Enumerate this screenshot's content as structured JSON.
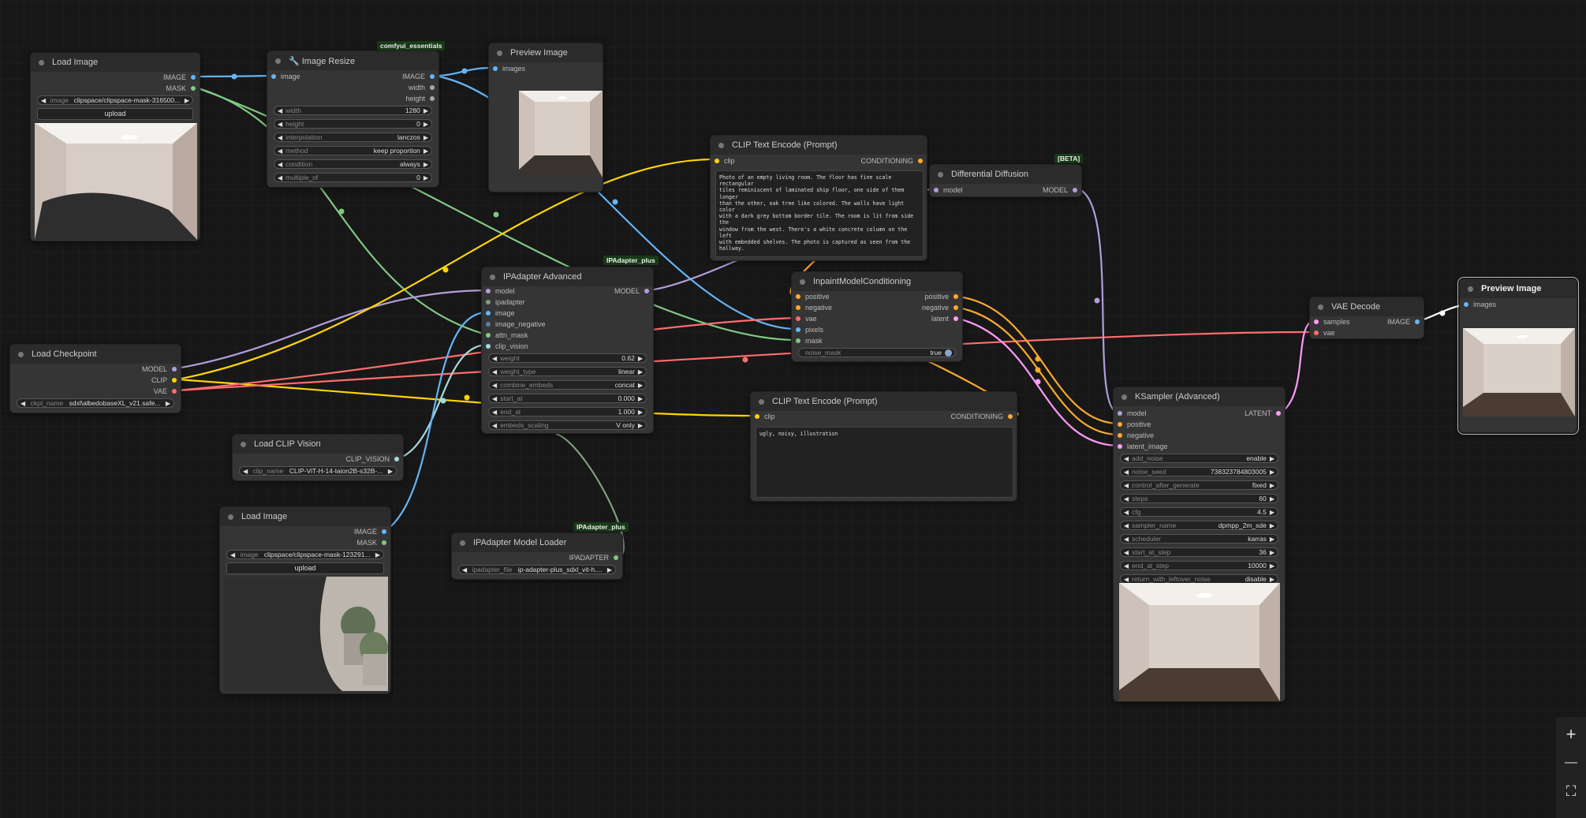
{
  "nodes": {
    "load_image_1": {
      "title": "Load Image",
      "out_image": "IMAGE",
      "out_mask": "MASK",
      "widget_label": "image",
      "widget_value": "clipspace/clipspace-mask-316500...",
      "upload": "upload"
    },
    "image_resize": {
      "badge": "comfyui_essentials",
      "title": "🔧 Image Resize",
      "in_image": "image",
      "out_image": "IMAGE",
      "out_width": "width",
      "out_height": "height",
      "widgets": [
        {
          "label": "width",
          "value": "1280"
        },
        {
          "label": "height",
          "value": "0"
        },
        {
          "label": "interpolation",
          "value": "lanczos"
        },
        {
          "label": "method",
          "value": "keep proportion"
        },
        {
          "label": "condition",
          "value": "always"
        },
        {
          "label": "multiple_of",
          "value": "0"
        }
      ]
    },
    "preview_image_1": {
      "title": "Preview Image",
      "in_images": "images"
    },
    "clip_text_1": {
      "title": "CLIP Text Encode (Prompt)",
      "in_clip": "clip",
      "out_cond": "CONDITIONING",
      "text": "Photo of an empty living room. The floor has fine scale rectangular\ntiles reminiscent of laminated ship floor, one side of them longer\nthan the other, oak tree like colored. The walls have light color\nwith a dark grey bottom border tile. The room is lit from side the\nwindow from the west. There's a white concrete column on the left\nwith embedded shelves. The photo is captured as seen from the\nhallway."
    },
    "diff_diffusion": {
      "badge": "[BETA]",
      "title": "Differential Diffusion",
      "in_model": "model",
      "out_model": "MODEL"
    },
    "ipadapter_adv": {
      "badge": "IPAdapter_plus",
      "title": "IPAdapter Advanced",
      "inputs": [
        "model",
        "ipadapter",
        "image",
        "image_negative",
        "attn_mask",
        "clip_vision"
      ],
      "out_model": "MODEL",
      "widgets": [
        {
          "label": "weight",
          "value": "0.62"
        },
        {
          "label": "weight_type",
          "value": "linear"
        },
        {
          "label": "combine_embeds",
          "value": "concat"
        },
        {
          "label": "start_at",
          "value": "0.000"
        },
        {
          "label": "end_at",
          "value": "1.000"
        },
        {
          "label": "embeds_scaling",
          "value": "V only"
        }
      ]
    },
    "inpaint_cond": {
      "title": "InpaintModelConditioning",
      "inputs": [
        "positive",
        "negative",
        "vae",
        "pixels",
        "mask"
      ],
      "outputs": [
        "positive",
        "negative",
        "latent"
      ],
      "toggle_label": "noise_mask",
      "toggle_value": "true"
    },
    "load_checkpoint": {
      "title": "Load Checkpoint",
      "outputs": [
        "MODEL",
        "CLIP",
        "VAE"
      ],
      "widget_label": "ckpt_name",
      "widget_value": "sdxl\\albedobaseXL_v21.safe..."
    },
    "clip_text_2": {
      "title": "CLIP Text Encode (Prompt)",
      "in_clip": "clip",
      "out_cond": "CONDITIONING",
      "text": "ugly, noisy, illustration"
    },
    "load_clip_vision": {
      "title": "Load CLIP Vision",
      "out": "CLIP_VISION",
      "widget_label": "clip_name",
      "widget_value": "CLIP-ViT-H-14-laion2B-s32B-..."
    },
    "load_image_2": {
      "title": "Load Image",
      "out_image": "IMAGE",
      "out_mask": "MASK",
      "widget_label": "image",
      "widget_value": "clipspace/clipspace-mask-123291...",
      "upload": "upload"
    },
    "ipadapter_loader": {
      "badge": "IPAdapter_plus",
      "title": "IPAdapter Model Loader",
      "out": "IPADAPTER",
      "widget_label": "ipadapter_file",
      "widget_value": "ip-adapter-plus_sdxl_vit-h...."
    },
    "vae_decode": {
      "title": "VAE Decode",
      "inputs": [
        "samples",
        "vae"
      ],
      "out": "IMAGE"
    },
    "ksampler": {
      "title": "KSampler (Advanced)",
      "inputs": [
        "model",
        "positive",
        "negative",
        "latent_image"
      ],
      "out": "LATENT",
      "widgets": [
        {
          "label": "add_noise",
          "value": "enable"
        },
        {
          "label": "noise_seed",
          "value": "738323784803005"
        },
        {
          "label": "control_after_generate",
          "value": "fixed"
        },
        {
          "label": "steps",
          "value": "60"
        },
        {
          "label": "cfg",
          "value": "4.5"
        },
        {
          "label": "sampler_name",
          "value": "dpmpp_2m_sde"
        },
        {
          "label": "scheduler",
          "value": "karras"
        },
        {
          "label": "start_at_step",
          "value": "36"
        },
        {
          "label": "end_at_step",
          "value": "10000"
        },
        {
          "label": "return_with_leftover_noise",
          "value": "disable"
        }
      ]
    },
    "preview_image_2": {
      "title": "Preview Image",
      "in_images": "images"
    }
  },
  "controls": {
    "zoom_in": "+",
    "zoom_out": "—",
    "fit": "⛶"
  },
  "colors": {
    "image": "#64b5f6",
    "mask": "#81c784",
    "model": "#b39ddb",
    "clip": "#ffd500",
    "vae": "#ff6e6e",
    "conditioning": "#ffa931",
    "latent": "#ff9cf9",
    "clip_vision": "#a8dadc",
    "ipadapter": "#7f9f7f"
  }
}
